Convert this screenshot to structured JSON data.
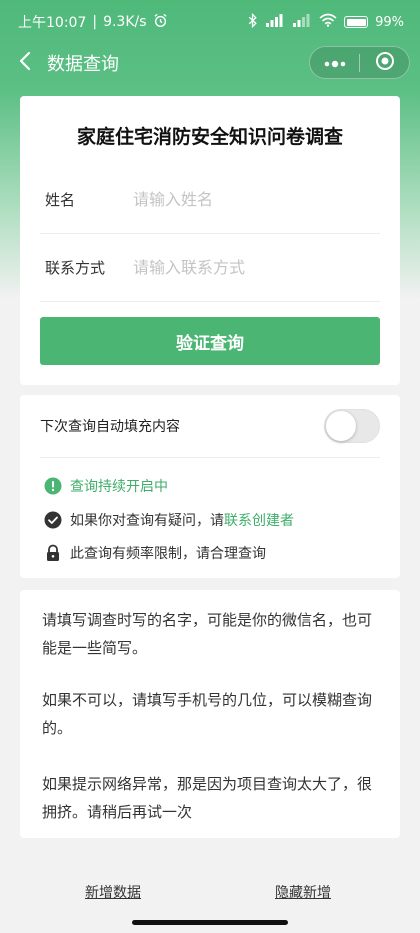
{
  "status_bar": {
    "time": "上午10:07",
    "network_speed": "9.3K/s",
    "battery": "99%"
  },
  "nav": {
    "title": "数据查询"
  },
  "form": {
    "title": "家庭住宅消防安全知识问卷调查",
    "name_label": "姓名",
    "name_placeholder": "请输入姓名",
    "contact_label": "联系方式",
    "contact_placeholder": "请输入联系方式",
    "submit_label": "验证查询"
  },
  "settings": {
    "autofill_label": "下次查询自动填充内容",
    "autofill_enabled": false,
    "status_text": "查询持续开启中",
    "question_text": "如果你对查询有疑问，请",
    "question_link": "联系创建者",
    "limit_text": "此查询有频率限制，请合理查询"
  },
  "notes": {
    "paragraphs": [
      "请填写调查时写的名字，可能是你的微信名，也可能是一些简写。",
      "如果不可以，请填写手机号的几位，可以模糊查询的。",
      "如果提示网络异常，那是因为项目查询太大了，很拥挤。请稍后再试一次"
    ]
  },
  "footer": {
    "add_data": "新增数据",
    "hide_add": "隐藏新增"
  },
  "colors": {
    "accent": "#4bb574",
    "link": "#3fae6a"
  }
}
